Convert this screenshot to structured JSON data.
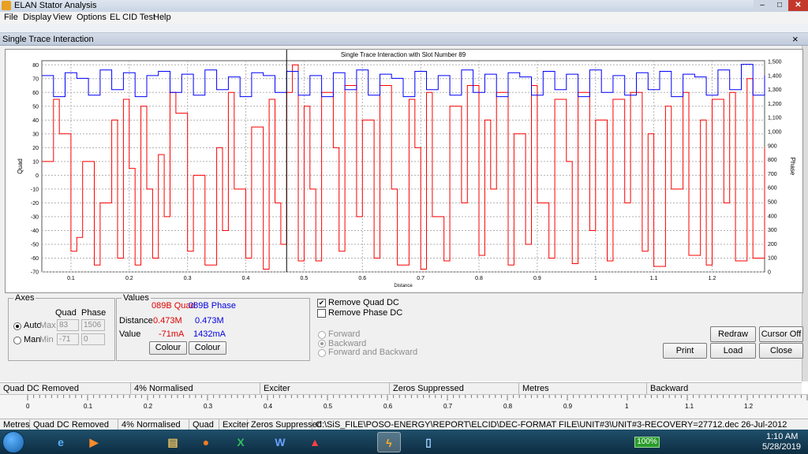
{
  "window": {
    "title": "ELAN Stator Analysis",
    "controls": {
      "minimize": "‒",
      "maximize": "□",
      "close": "✕"
    }
  },
  "menu": [
    "File",
    "Display",
    "View",
    "Options",
    "EL CID Test",
    "Help"
  ],
  "child": {
    "title": "Single Trace Interaction",
    "close": "×"
  },
  "chart_data": {
    "type": "line",
    "title": "Single Trace Interaction with Slot Number 89",
    "xlabel": "Distance",
    "ylabel": "Quad",
    "y2label": "Phase",
    "xlim": [
      0.05,
      1.29
    ],
    "ylim": [
      -70,
      83
    ],
    "y2lim": [
      0,
      1506
    ],
    "xticks": [
      "0.1",
      "0.2",
      "0.3",
      "0.4",
      "0.5",
      "0.6",
      "0.7",
      "0.8",
      "0.9",
      "1",
      "1.1",
      "1.2"
    ],
    "yticks": [
      "80",
      "70",
      "60",
      "50",
      "40",
      "30",
      "20",
      "10",
      "0",
      "-10",
      "-20",
      "-30",
      "-40",
      "-50",
      "-60",
      "-70"
    ],
    "y2ticks": [
      "1,500",
      "1,400",
      "1,300",
      "1,200",
      "1,100",
      "1,000",
      "900",
      "800",
      "700",
      "600",
      "500",
      "400",
      "300",
      "200",
      "100",
      "0"
    ],
    "grid": true,
    "cursor_x": 0.47,
    "series": [
      {
        "name": "089B Quad",
        "axis": "left",
        "color": "#ff0000",
        "x": [
          0.05,
          0.07,
          0.08,
          0.1,
          0.11,
          0.12,
          0.14,
          0.15,
          0.17,
          0.18,
          0.19,
          0.2,
          0.21,
          0.22,
          0.23,
          0.24,
          0.25,
          0.26,
          0.27,
          0.28,
          0.3,
          0.31,
          0.33,
          0.35,
          0.36,
          0.37,
          0.38,
          0.4,
          0.41,
          0.43,
          0.44,
          0.45,
          0.46,
          0.47,
          0.48,
          0.49,
          0.5,
          0.51,
          0.52,
          0.53,
          0.55,
          0.56,
          0.57,
          0.59,
          0.6,
          0.62,
          0.63,
          0.65,
          0.66,
          0.68,
          0.69,
          0.7,
          0.71,
          0.72,
          0.74,
          0.75,
          0.77,
          0.78,
          0.8,
          0.81,
          0.82,
          0.83,
          0.85,
          0.86,
          0.88,
          0.89,
          0.9,
          0.92,
          0.93,
          0.95,
          0.96,
          0.97,
          0.99,
          1.0,
          1.02,
          1.03,
          1.05,
          1.06,
          1.08,
          1.09,
          1.1,
          1.12,
          1.13,
          1.15,
          1.16,
          1.18,
          1.19,
          1.2,
          1.22,
          1.23,
          1.24,
          1.26,
          1.27,
          1.29
        ],
        "y": [
          10,
          55,
          30,
          -55,
          -45,
          10,
          -65,
          -20,
          40,
          -60,
          55,
          5,
          -65,
          50,
          -10,
          -60,
          15,
          -30,
          60,
          45,
          -55,
          0,
          -65,
          20,
          -40,
          60,
          -10,
          -60,
          35,
          -68,
          55,
          -20,
          -50,
          60,
          80,
          -62,
          50,
          -10,
          -62,
          60,
          20,
          -55,
          65,
          -30,
          40,
          -60,
          65,
          -10,
          -65,
          55,
          20,
          -68,
          60,
          -30,
          -62,
          50,
          -20,
          65,
          -58,
          40,
          -10,
          60,
          -65,
          30,
          -50,
          65,
          -20,
          -60,
          55,
          10,
          -64,
          60,
          -40,
          40,
          -62,
          55,
          -20,
          60,
          -55,
          30,
          -66,
          50,
          -10,
          60,
          -58,
          40,
          -65,
          55,
          -20,
          60,
          -62,
          70,
          -60,
          20
        ]
      },
      {
        "name": "089B Phase",
        "axis": "right",
        "color": "#0000ff",
        "x": [
          0.05,
          0.07,
          0.09,
          0.11,
          0.13,
          0.15,
          0.17,
          0.19,
          0.21,
          0.23,
          0.25,
          0.27,
          0.29,
          0.31,
          0.33,
          0.35,
          0.37,
          0.39,
          0.41,
          0.43,
          0.45,
          0.47,
          0.49,
          0.51,
          0.53,
          0.55,
          0.57,
          0.59,
          0.61,
          0.63,
          0.65,
          0.67,
          0.69,
          0.71,
          0.73,
          0.75,
          0.77,
          0.79,
          0.81,
          0.83,
          0.85,
          0.87,
          0.89,
          0.91,
          0.93,
          0.95,
          0.97,
          0.99,
          1.01,
          1.03,
          1.05,
          1.07,
          1.09,
          1.11,
          1.13,
          1.15,
          1.17,
          1.19,
          1.21,
          1.23,
          1.25,
          1.27,
          1.29
        ],
        "y": [
          1400,
          1250,
          1420,
          1380,
          1260,
          1440,
          1300,
          1420,
          1250,
          1400,
          1430,
          1280,
          1410,
          1260,
          1440,
          1300,
          1390,
          1250,
          1420,
          1400,
          1280,
          1430,
          1260,
          1400,
          1250,
          1420,
          1300,
          1440,
          1260,
          1410,
          1380,
          1250,
          1430,
          1300,
          1400,
          1260,
          1440,
          1280,
          1410,
          1250,
          1420,
          1390,
          1260,
          1430,
          1300,
          1410,
          1250,
          1440,
          1280,
          1400,
          1260,
          1420,
          1300,
          1430,
          1250,
          1410,
          1390,
          1260,
          1440,
          1300,
          1480,
          1260,
          1400
        ]
      }
    ]
  },
  "axes_panel": {
    "title": "Axes",
    "col_quad": "Quad",
    "col_phase": "Phase",
    "auto_label": "Auto",
    "man_label": "Man",
    "max_label": "Max",
    "min_label": "Min",
    "max_quad": "83",
    "max_phase": "1506",
    "min_quad": "-71",
    "min_phase": "0"
  },
  "values_panel": {
    "title": "Values",
    "col_quad": "089B Quad",
    "col_phase": "089B Phase",
    "distance_label": "Distance",
    "value_label": "Value",
    "distance_quad": "0.473M",
    "distance_phase": "0.473M",
    "value_quad": "-71mA",
    "value_phase": "1432mA",
    "colour_label": "Colour"
  },
  "options": {
    "remove_quad_dc": "Remove Quad DC",
    "remove_phase_dc": "Remove Phase DC",
    "forward": "Forward",
    "backward": "Backward",
    "forward_backward": "Forward and Backward",
    "check": "✔"
  },
  "buttons": {
    "redraw": "Redraw",
    "cursor_off": "Cursor Off",
    "print": "Print",
    "load": "Load",
    "close": "Close"
  },
  "child_status": [
    "Quad DC Removed",
    "4% Normalised",
    "Exciter",
    "Zeros Suppressed",
    "Metres",
    "Backward"
  ],
  "ruler_ticks": [
    "0",
    "0.1",
    "0.2",
    "0.3",
    "0.4",
    "0.5",
    "0.6",
    "0.7",
    "0.8",
    "0.9",
    "1",
    "1.1",
    "1.2"
  ],
  "main_status": [
    "Metres",
    "Quad DC Removed",
    "4% Normalised",
    "Quad",
    "Exciter",
    "Zeros Suppressed",
    "C:\\SiS_FILE\\POSO-ENERGY\\REPORT\\ELCID\\DEC-FORMAT FILE\\UNIT#3\\UNIT#3-RECOVERY=27712.dec 26-Jul-2012"
  ],
  "taskbar": {
    "apps": [
      "e",
      "▶",
      "▤",
      "●",
      "X",
      "W",
      "▲",
      "ϟ",
      "▯"
    ],
    "battery": "100%",
    "time": "1:10 AM",
    "date": "5/28/2019"
  }
}
